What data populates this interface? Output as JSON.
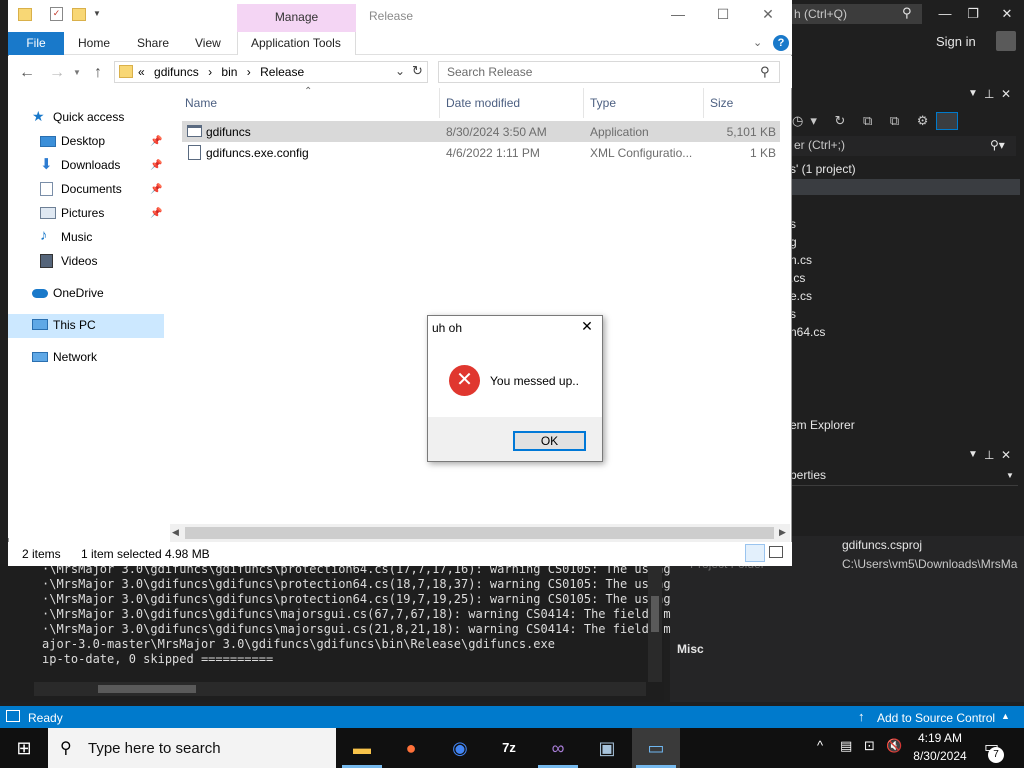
{
  "vs": {
    "search_placeholder": "h (Ctrl+Q)",
    "signin": "Sign in",
    "solution_search": "er (Ctrl+;)",
    "solution_label": "s' (1 project)",
    "files": [
      "s",
      "g",
      "n.cs",
      ".cs",
      "e.cs",
      "s",
      "n64.cs"
    ],
    "solution_explorer_tab": "em Explorer",
    "properties_header": "perties",
    "prop_name": "gdifuncs.csproj",
    "prop_folder_label": "Project Folder",
    "prop_path": "C:\\Users\\vm5\\Downloads\\MrsMa",
    "prop_misc": "Misc",
    "output_lines": [
      "·\\MrsMajor 3.0\\gdifuncs\\gdifuncs\\protection64.cs(17,7,17,16): warning CS0105: The using",
      "·\\MrsMajor 3.0\\gdifuncs\\gdifuncs\\protection64.cs(18,7,18,37): warning CS0105: The using",
      "·\\MrsMajor 3.0\\gdifuncs\\gdifuncs\\protection64.cs(19,7,19,25): warning CS0105: The using",
      "·\\MrsMajor 3.0\\gdifuncs\\gdifuncs\\majorsgui.cs(67,7,67,18): warning CS0414: The field 'm",
      "·\\MrsMajor 3.0\\gdifuncs\\gdifuncs\\majorsgui.cs(21,8,21,18): warning CS0414: The field 'm",
      "ajor-3.0-master\\MrsMajor 3.0\\gdifuncs\\gdifuncs\\bin\\Release\\gdifuncs.exe",
      "ıp-to-date, 0 skipped =========="
    ],
    "status_ready": "Ready",
    "status_source_control": "Add to Source Control"
  },
  "explorer": {
    "title": "Release",
    "manage_label": "Manage",
    "ribbon_tabs": [
      "File",
      "Home",
      "Share",
      "View",
      "Application Tools"
    ],
    "breadcrumb": [
      "gdifuncs",
      "bin",
      "Release"
    ],
    "search_placeholder": "Search Release",
    "nav_items": [
      {
        "label": "Quick access",
        "icon": "star-icon"
      },
      {
        "label": "Desktop",
        "icon": "desktop-icon",
        "pinned": true
      },
      {
        "label": "Downloads",
        "icon": "download-icon",
        "pinned": true
      },
      {
        "label": "Documents",
        "icon": "documents-icon",
        "pinned": true
      },
      {
        "label": "Pictures",
        "icon": "pictures-icon",
        "pinned": true
      },
      {
        "label": "Music",
        "icon": "music-icon"
      },
      {
        "label": "Videos",
        "icon": "videos-icon"
      },
      {
        "label": "OneDrive",
        "icon": "cloud-icon"
      },
      {
        "label": "This PC",
        "icon": "computer-icon"
      },
      {
        "label": "Network",
        "icon": "network-icon"
      }
    ],
    "columns": [
      "Name",
      "Date modified",
      "Type",
      "Size"
    ],
    "files": [
      {
        "name": "gdifuncs",
        "date": "8/30/2024 3:50 AM",
        "type": "Application",
        "size": "5,101 KB"
      },
      {
        "name": "gdifuncs.exe.config",
        "date": "4/6/2022 1:11 PM",
        "type": "XML Configuratio...",
        "size": "1 KB"
      }
    ],
    "status_count": "2 items",
    "status_selected": "1 item selected",
    "status_size": "4.98 MB"
  },
  "dialog": {
    "title": "uh oh",
    "message": "You messed up..",
    "ok_label": "OK"
  },
  "taskbar": {
    "search_placeholder": "Type here to search",
    "time": "4:19 AM",
    "date": "8/30/2024",
    "notification_count": "7"
  },
  "colors": {
    "accent": "#0078d7",
    "vs_status": "#007acc",
    "error_red": "#e0372f",
    "manage_tab": "#f4d5f4"
  }
}
